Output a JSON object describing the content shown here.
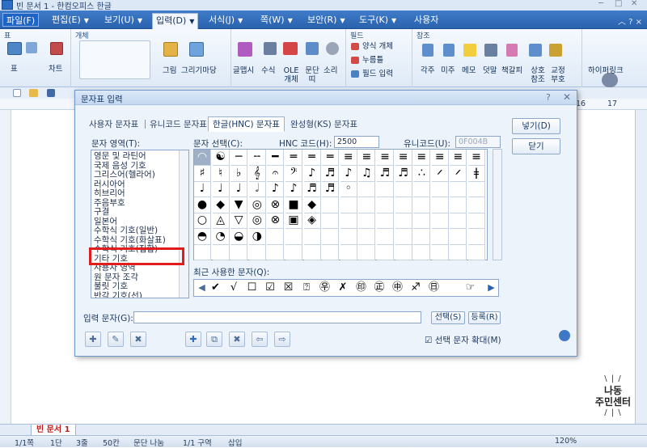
{
  "window": {
    "title": "빈 문서 1 - 한컴오피스 한글",
    "minimize": "─",
    "restore": "□",
    "close": "✕"
  },
  "menu": {
    "items": [
      "파일(F)",
      "편집(E)",
      "보기(U)",
      "입력(D)",
      "서식(J)",
      "쪽(W)",
      "보안(R)",
      "도구(K)",
      "사용자"
    ],
    "selected": "입력(D)",
    "right": "︿ ? ×"
  },
  "ribbon": {
    "groups": [
      "표",
      "개체",
      "필드",
      "참조"
    ],
    "buttons": {
      "table": "표",
      "chart": "차트",
      "picture": "그림",
      "draw_market": "그리기마당",
      "glyph": "글맵시",
      "formula": "수식",
      "ole": "OLE\n개체",
      "para_border": "문단\n띠",
      "sound": "소리",
      "form_object": "양식 개체",
      "push_button": "누름틀",
      "field_input": "필드 입력",
      "footnote": "각주",
      "endnote": "미주",
      "memo": "메모",
      "comment": "덧말",
      "bookmark": "책갈피",
      "cross_ref": "상호\n참조",
      "corr_mark": "교정\n부호",
      "hyperlink": "하이퍼링크"
    }
  },
  "ruler": {
    "marks": [
      "16",
      "17"
    ]
  },
  "dialog": {
    "title": "문자표 입력",
    "help": "?",
    "tabs": [
      "사용자 문자표",
      "유니코드 문자표",
      "한글(HNC) 문자표",
      "완성형(KS) 문자표"
    ],
    "selected_tab": "한글(HNC) 문자표",
    "area_label": "문자 영역(T):",
    "select_label": "문자 선택(C):",
    "hnc_code_label": "HNC 코드(H):",
    "hnc_code_value": "2500",
    "unicode_label": "유니코드(U):",
    "unicode_value": "0F004B",
    "areas": [
      "영문 및 라틴어",
      "국제 음성 기호",
      "그리스어(헬라어)",
      "러시아어",
      "히브리어",
      "주음부호",
      "구결",
      "일본어",
      "수학식 기호(일반)",
      "수학식 기호(화살표)",
      "수학식 기호(집합)",
      "기타 기호",
      "사용자 영역",
      "원 문자 조각",
      "불릿 기호",
      "반각 기호(선)"
    ],
    "selected_area": "기타 기호",
    "grid_rows": [
      [
        "◠",
        "☯",
        "─",
        "╌",
        "━",
        "═",
        "═",
        "═",
        "≡",
        "≡",
        "≡",
        "≡",
        "≡",
        "≡",
        "≡",
        "≡"
      ],
      [
        "♯",
        "♮",
        "♭",
        "𝄞",
        "𝄐",
        "𝄢",
        "♪",
        "♬",
        "♪",
        "♫",
        "♬",
        "♬",
        "∴",
        "𝄍",
        "𝄍",
        "ǂ"
      ],
      [
        "♩",
        "♩",
        "♩",
        "𝅗𝅥",
        "♪",
        "♪",
        "♬",
        "♬",
        "◦",
        "",
        "",
        "",
        "",
        "",
        "",
        ""
      ],
      [
        "●",
        "◆",
        "▼",
        "◎",
        "⊗",
        "■",
        "◆",
        "",
        "",
        "",
        "",
        "",
        "",
        "",
        "",
        ""
      ],
      [
        "○",
        "◬",
        "▽",
        "◎",
        "⊗",
        "▣",
        "◈",
        "",
        "",
        "",
        "",
        "",
        "",
        "",
        "",
        ""
      ],
      [
        "◓",
        "◔",
        "◒",
        "◑",
        "",
        "",
        "",
        "",
        "",
        "",
        "",
        "",
        "",
        "",
        "",
        ""
      ],
      [
        "",
        "",
        "",
        "",
        "",
        "",
        "",
        "",
        "",
        "",
        "",
        "",
        "",
        "",
        "",
        ""
      ]
    ],
    "recent_label": "최근 사용한 문자(Q):",
    "recent": [
      "✔",
      "√",
      "☐",
      "☑",
      "☒",
      "⍰",
      "㉾",
      "✗",
      "㊞",
      "㊣",
      "㊥",
      "♐",
      "㊐",
      "",
      "☞"
    ],
    "input_label": "입력 문자(G):",
    "select_button": "선택(S)",
    "register_button": "등록(R)",
    "zoom_checkbox_label": "선택 문자 확대(M)",
    "insert_button": "넣기(D)",
    "close_button": "닫기"
  },
  "tabs": {
    "document": "빈 문서 1"
  },
  "status": {
    "page": "1/1쪽",
    "section": "1단",
    "line": "3줄",
    "column": "50칸",
    "paragraph": "문단 나눔",
    "region": "1/1 구역",
    "mode": "삽입",
    "zoom": "120%"
  },
  "watermark": {
    "line1": "나동",
    "line2": "주민센터"
  },
  "colors": {
    "menubar": "#2f6bb8",
    "highlight": "#e01c1c",
    "selected_tab_text": "#13345d"
  }
}
